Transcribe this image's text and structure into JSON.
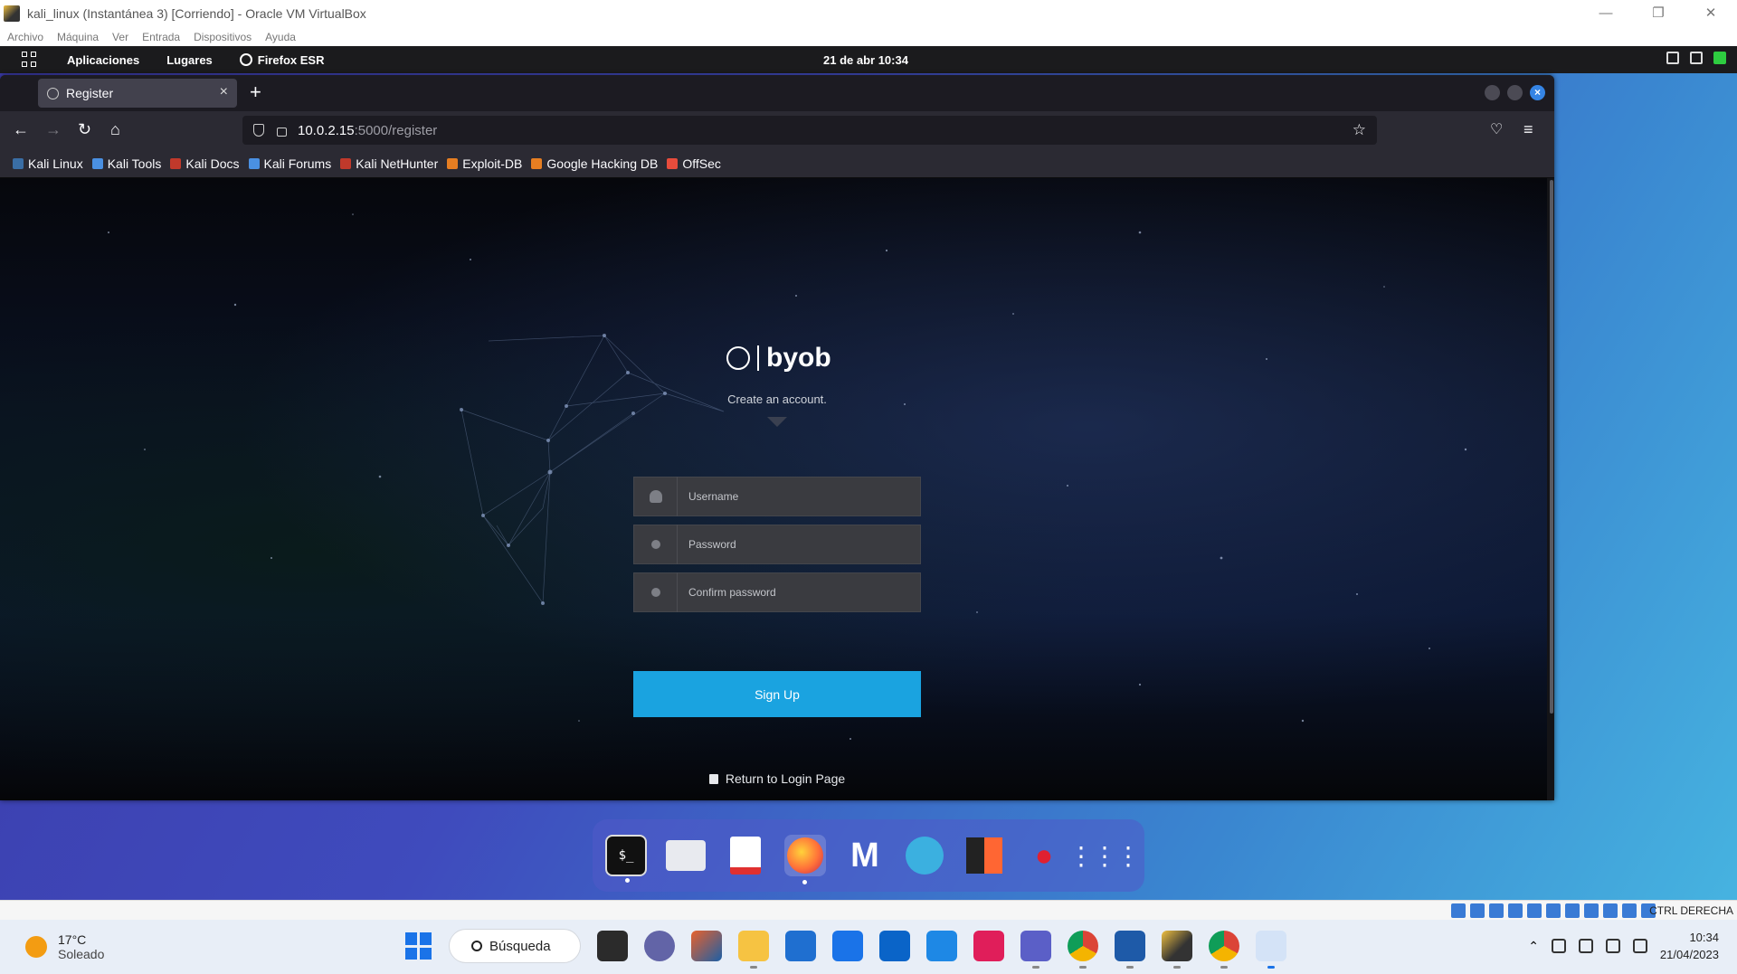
{
  "vbox": {
    "title": "kali_linux (Instantánea 3) [Corriendo] - Oracle VM VirtualBox",
    "menu": [
      "Archivo",
      "Máquina",
      "Ver",
      "Entrada",
      "Dispositivos",
      "Ayuda"
    ],
    "hostkey": "CTRL DERECHA"
  },
  "gnome": {
    "apps_label": "Aplicaciones",
    "places_label": "Lugares",
    "firefox_label": "Firefox ESR",
    "clock": "21 de abr  10:34"
  },
  "firefox": {
    "tab_title": "Register",
    "url_host": "10.0.2.15",
    "url_rest": ":5000/register",
    "bookmarks": [
      "Kali Linux",
      "Kali Tools",
      "Kali Docs",
      "Kali Forums",
      "Kali NetHunter",
      "Exploit-DB",
      "Google Hacking DB",
      "OffSec"
    ],
    "bookmark_colors": [
      "#3a6ea5",
      "#4a90e2",
      "#c0392b",
      "#4a90e2",
      "#c0392b",
      "#e67e22",
      "#e67e22",
      "#e74c3c"
    ]
  },
  "page": {
    "logo_word": "byob",
    "subtitle": "Create an account.",
    "username_placeholder": "Username",
    "password_placeholder": "Password",
    "confirm_placeholder": "Confirm password",
    "signup_label": "Sign Up",
    "return_label": "Return to Login Page",
    "accent": "#1aa3e0"
  },
  "dock": {
    "apps": [
      "terminal-icon",
      "files-icon",
      "text-editor-icon",
      "firefox-icon",
      "metasploit-icon",
      "wireshark-icon",
      "burpsuite-icon",
      "cherrytree-icon",
      "show-apps-icon"
    ]
  },
  "taskbar": {
    "temperature": "17°C",
    "weather": "Soleado",
    "search_label": "Búsqueda",
    "time": "10:34",
    "date": "21/04/2023"
  }
}
